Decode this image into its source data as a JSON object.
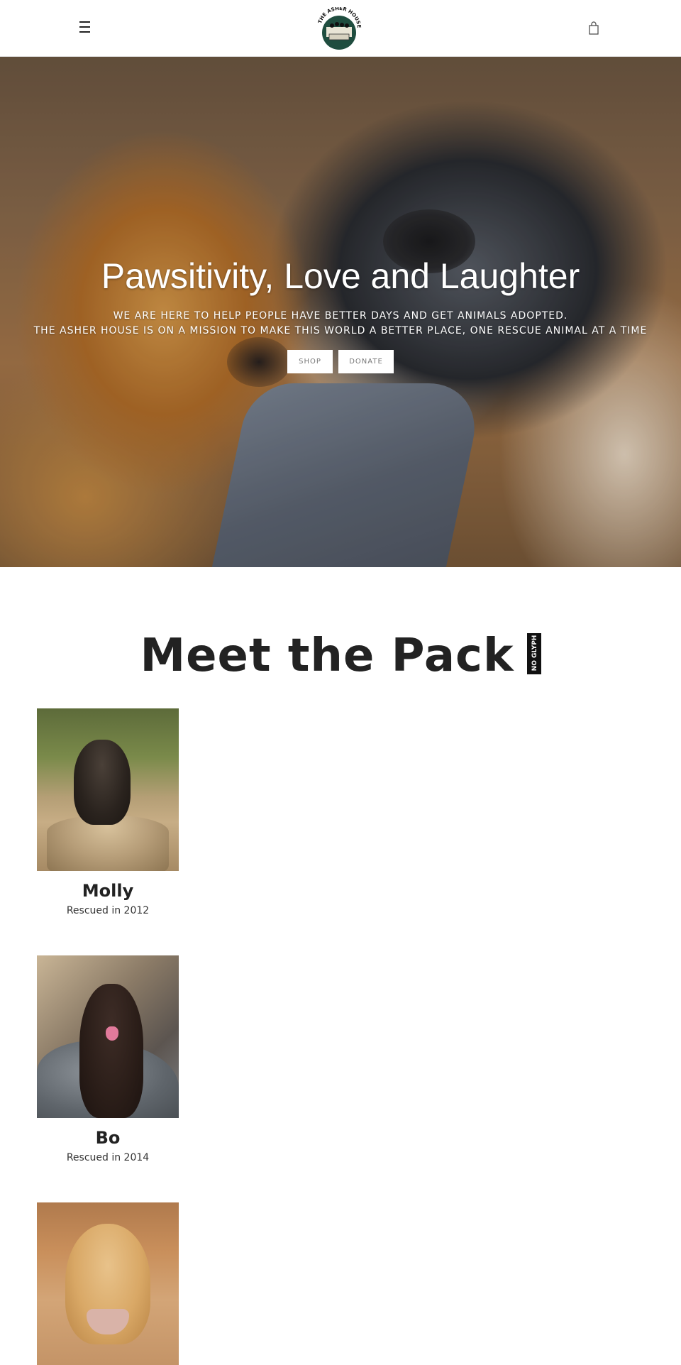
{
  "header": {
    "menu_icon": "hamburger-menu-icon",
    "logo_text": "THE ASHER HOUSE",
    "cart_icon": "shopping-bag-icon"
  },
  "hero": {
    "title": "Pawsitivity, Love and Laughter",
    "subtitle_line1": "WE ARE HERE TO HELP PEOPLE HAVE BETTER DAYS AND GET ANIMALS ADOPTED.",
    "subtitle_line2": "THE ASHER HOUSE IS ON A MISSION TO MAKE THIS WORLD A BETTER PLACE, ONE RESCUE ANIMAL AT A TIME",
    "buttons": [
      {
        "label": "SHOP"
      },
      {
        "label": "DONATE"
      }
    ]
  },
  "pack": {
    "title": "Meet the Pack",
    "missing_glyph_text": "NO GLYPH",
    "dogs": [
      {
        "name": "Molly",
        "rescued": "Rescued in 2012"
      },
      {
        "name": "Bo",
        "rescued": "Rescued in 2014"
      },
      {
        "name": "",
        "rescued": ""
      }
    ]
  }
}
